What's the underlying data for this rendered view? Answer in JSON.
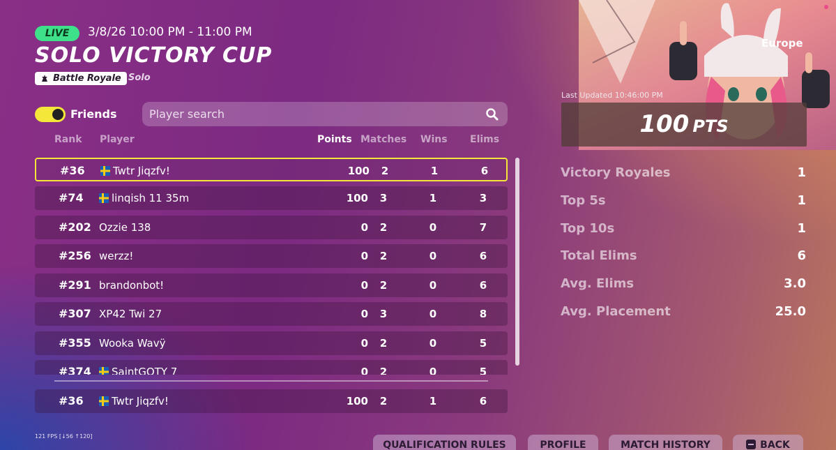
{
  "event": {
    "live_label": "LIVE",
    "time": "3/8/26 10:00 PM - 11:00 PM",
    "title": "SOLO VICTORY CUP",
    "mode": "Battle Royale",
    "submode": "Solo"
  },
  "filters": {
    "friends_label": "Friends",
    "friends_on": true,
    "search_placeholder": "Player search"
  },
  "table": {
    "headers": {
      "rank": "Rank",
      "player": "Player",
      "points": "Points",
      "matches": "Matches",
      "wins": "Wins",
      "elims": "Elims"
    },
    "rows": [
      {
        "rank": "#36",
        "player": "Twtr Jiqzfv!",
        "flag": true,
        "points": "100",
        "matches": "2",
        "wins": "1",
        "elims": "6",
        "highlight": true
      },
      {
        "rank": "#74",
        "player": "linqish 11 35m",
        "flag": true,
        "points": "100",
        "matches": "3",
        "wins": "1",
        "elims": "3"
      },
      {
        "rank": "#202",
        "player": "Ozzie 138",
        "flag": false,
        "points": "0",
        "matches": "2",
        "wins": "0",
        "elims": "7"
      },
      {
        "rank": "#256",
        "player": "werzz!",
        "flag": false,
        "points": "0",
        "matches": "2",
        "wins": "0",
        "elims": "6"
      },
      {
        "rank": "#291",
        "player": "brandonbot!",
        "flag": false,
        "points": "0",
        "matches": "2",
        "wins": "0",
        "elims": "6"
      },
      {
        "rank": "#307",
        "player": "XP42 Twi 27",
        "flag": false,
        "points": "0",
        "matches": "3",
        "wins": "0",
        "elims": "8"
      },
      {
        "rank": "#355",
        "player": "Wooka Wavÿ",
        "flag": false,
        "points": "0",
        "matches": "2",
        "wins": "0",
        "elims": "5"
      },
      {
        "rank": "#374",
        "player": "SaintGOTY 7",
        "flag": true,
        "points": "0",
        "matches": "2",
        "wins": "0",
        "elims": "5"
      }
    ],
    "my_row": {
      "rank": "#36",
      "player": "Twtr Jiqzfv!",
      "flag": true,
      "points": "100",
      "matches": "2",
      "wins": "1",
      "elims": "6"
    }
  },
  "summary": {
    "region": "Europe",
    "last_updated": "Last Updated 10:46:00 PM",
    "points": "100",
    "points_unit": "PTS",
    "stats": [
      {
        "label": "Victory Royales",
        "value": "1"
      },
      {
        "label": "Top 5s",
        "value": "1"
      },
      {
        "label": "Top 10s",
        "value": "1"
      },
      {
        "label": "Total Elims",
        "value": "6"
      },
      {
        "label": "Avg. Elims",
        "value": "3.0"
      },
      {
        "label": "Avg. Placement",
        "value": "25.0"
      }
    ]
  },
  "footer": {
    "fps": "121 FPS [↓56 ↑120]",
    "buttons": {
      "qualification": "QUALIFICATION RULES",
      "profile": "PROFILE",
      "match_history": "MATCH HISTORY",
      "back": "BACK"
    }
  },
  "colors": {
    "live": "#3fe08a",
    "highlight": "#f5e63a",
    "toggle": "#f5e63a",
    "flag_blue": "#1a5fb4",
    "flag_yellow": "#f5cc16"
  }
}
